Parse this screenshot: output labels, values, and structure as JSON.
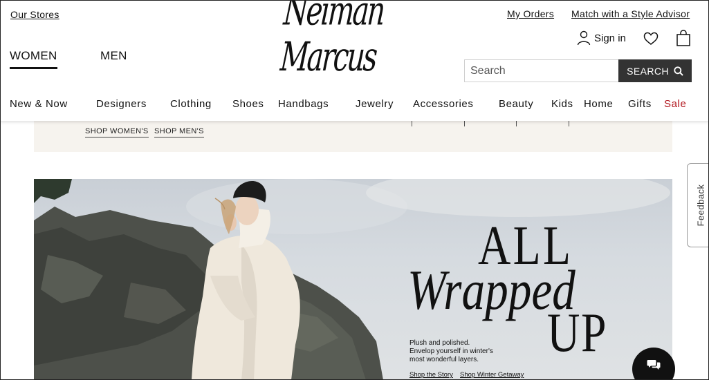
{
  "header": {
    "our_stores": "Our Stores",
    "gender_tabs": [
      {
        "label": "WOMEN",
        "active": true
      },
      {
        "label": "MEN",
        "active": false
      }
    ],
    "logo_text": "Neiman Marcus",
    "my_orders": "My Orders",
    "style_advisor": "Match with a Style Advisor",
    "sign_in": "Sign in",
    "search": {
      "placeholder": "Search",
      "value": "",
      "button_label": "SEARCH"
    },
    "icons": {
      "user": "user-icon",
      "favorites": "heart-icon",
      "bag": "shopping-bag-icon",
      "search": "search-icon"
    }
  },
  "nav": {
    "items": [
      {
        "label": "New & Now"
      },
      {
        "label": "Designers"
      },
      {
        "label": "Clothing"
      },
      {
        "label": "Shoes"
      },
      {
        "label": "Handbags"
      },
      {
        "label": "Jewelry"
      },
      {
        "label": "Accessories"
      },
      {
        "label": "Beauty"
      },
      {
        "label": "Kids"
      },
      {
        "label": "Home"
      },
      {
        "label": "Gifts"
      },
      {
        "label": "Sale"
      }
    ],
    "sale_color": "#b1141c"
  },
  "promo": {
    "shop_women": "SHOP WOMEN'S",
    "shop_men": "SHOP MEN'S"
  },
  "feedback_tab": "Feedback",
  "hero": {
    "headline_line1": "ALL",
    "headline_line2": "Wrapped",
    "headline_line3": "UP",
    "copy_line1": "Plush and polished.",
    "copy_line2": "Envelop yourself in winter's",
    "copy_line3": "most wonderful layers.",
    "link_story": "Shop the Story",
    "link_getaway": "Shop Winter Getaway"
  },
  "chat": {
    "icon": "chat-bubbles-icon"
  },
  "colors": {
    "search_button": "#333333",
    "promo_bg": "#f6f3ee",
    "text": "#111111"
  }
}
